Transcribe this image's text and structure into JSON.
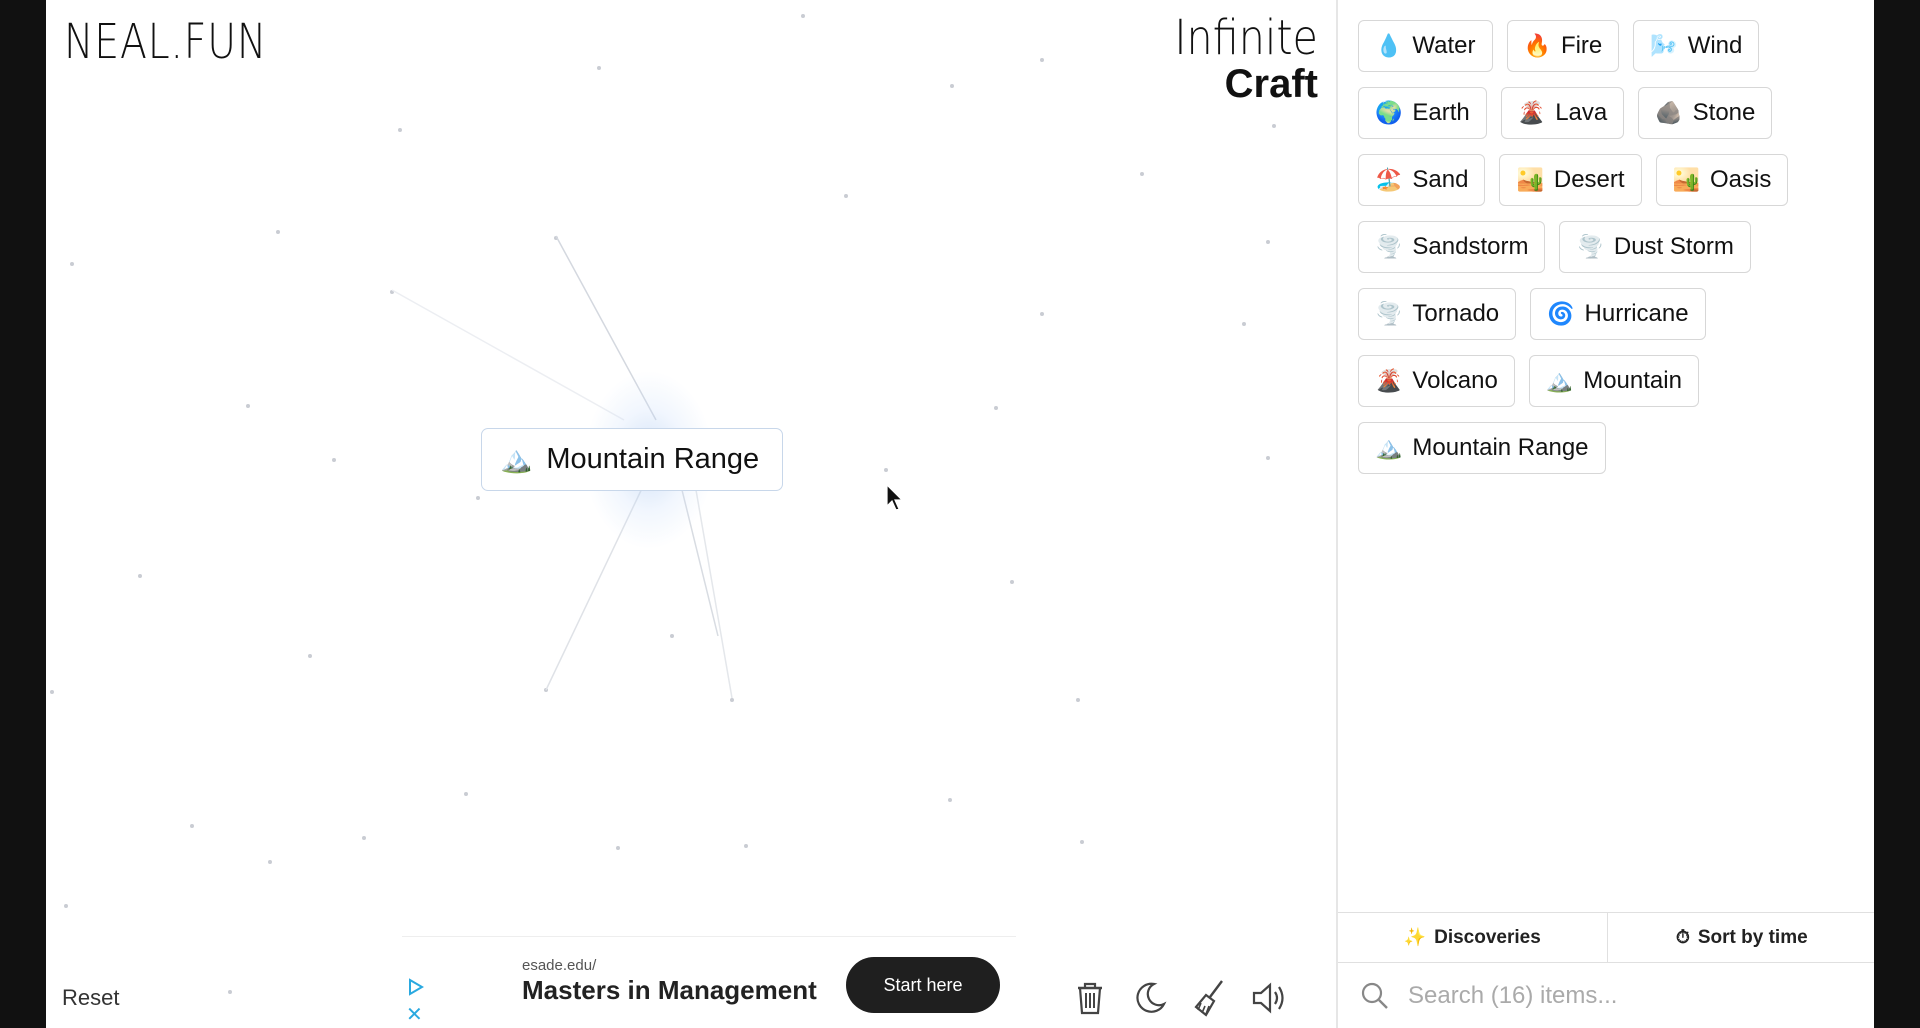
{
  "header": {
    "neal_logo": "NEAL.FUN",
    "infinite_logo_line1": "Infinite",
    "infinite_logo_line2": "Craft"
  },
  "canvas": {
    "placed_item": {
      "emoji": "🏔️",
      "label": "Mountain Range"
    },
    "reset_label": "Reset"
  },
  "ad": {
    "url": "esade.edu/",
    "headline": "Masters in Management",
    "cta": "Start here",
    "close": "✕"
  },
  "toolbar": {
    "icons": [
      "trash-icon",
      "moon-icon",
      "broom-icon",
      "speaker-icon"
    ]
  },
  "sidebar": {
    "items": [
      {
        "emoji": "💧",
        "label": "Water"
      },
      {
        "emoji": "🔥",
        "label": "Fire"
      },
      {
        "emoji": "🌬️",
        "label": "Wind"
      },
      {
        "emoji": "🌍",
        "label": "Earth"
      },
      {
        "emoji": "🌋",
        "label": "Lava"
      },
      {
        "emoji": "🪨",
        "label": "Stone"
      },
      {
        "emoji": "🏖️",
        "label": "Sand"
      },
      {
        "emoji": "🏜️",
        "label": "Desert"
      },
      {
        "emoji": "🏜️",
        "label": "Oasis"
      },
      {
        "emoji": "🌪️",
        "label": "Sandstorm"
      },
      {
        "emoji": "🌪️",
        "label": "Dust Storm"
      },
      {
        "emoji": "🌪️",
        "label": "Tornado"
      },
      {
        "emoji": "🌀",
        "label": "Hurricane"
      },
      {
        "emoji": "🌋",
        "label": "Volcano"
      },
      {
        "emoji": "🏔️",
        "label": "Mountain"
      },
      {
        "emoji": "🏔️",
        "label": "Mountain Range"
      }
    ],
    "tabs": [
      {
        "icon": "✨",
        "label": "Discoveries"
      },
      {
        "icon": "⏱",
        "label": "Sort by time"
      }
    ],
    "search_placeholder": "Search (16) items..."
  }
}
